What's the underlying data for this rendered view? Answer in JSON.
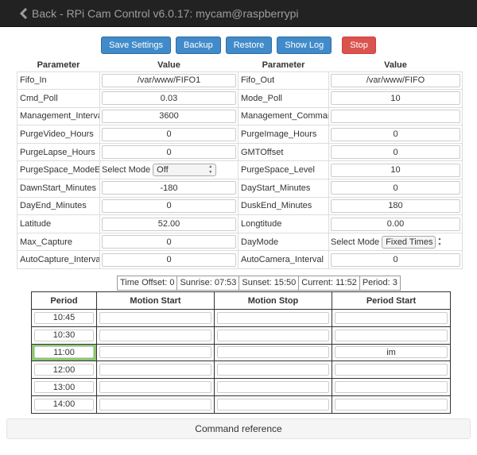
{
  "navbar": {
    "back_label": "Back - RPi Cam Control v6.0.17: mycam@raspberrypi"
  },
  "buttons": {
    "save_settings": "Save Settings",
    "backup": "Backup",
    "restore": "Restore",
    "show_log": "Show Log",
    "stop": "Stop"
  },
  "settings": {
    "headers": {
      "param_left": "Parameter",
      "value_left": "Value",
      "param_right": "Parameter",
      "value_right": "Value"
    },
    "rows": [
      {
        "left_label": "Fifo_In",
        "left_value": "/var/www/FIFO1",
        "right_label": "Fifo_Out",
        "right_value": "/var/www/FIFO"
      },
      {
        "left_label": "Cmd_Poll",
        "left_value": "0.03",
        "right_label": "Mode_Poll",
        "right_value": "10"
      },
      {
        "left_label": "Management_Interval",
        "left_value": "3600",
        "right_label": "Management_Command",
        "right_value": ""
      },
      {
        "left_label": "PurgeVideo_Hours",
        "left_value": "0",
        "right_label": "PurgeImage_Hours",
        "right_value": "0"
      },
      {
        "left_label": "PurgeLapse_Hours",
        "left_value": "0",
        "right_label": "GMTOffset",
        "right_value": "0"
      },
      {
        "left_label": "PurgeSpace_ModeEx",
        "left_select_prefix": "Select Mode",
        "left_select_value": "Off",
        "right_label": "PurgeSpace_Level",
        "right_value": "10"
      },
      {
        "left_label": "DawnStart_Minutes",
        "left_value": "-180",
        "right_label": "DayStart_Minutes",
        "right_value": "0"
      },
      {
        "left_label": "DayEnd_Minutes",
        "left_value": "0",
        "right_label": "DuskEnd_Minutes",
        "right_value": "180"
      },
      {
        "left_label": "Latitude",
        "left_value": "52.00",
        "right_label": "Longtitude",
        "right_value": "0.00"
      },
      {
        "left_label": "Max_Capture",
        "left_value": "0",
        "right_label": "DayMode",
        "right_select_prefix": "Select Mode",
        "right_select_value": "Fixed Times"
      },
      {
        "left_label": "AutoCapture_Interval",
        "left_value": "0",
        "right_label": "AutoCamera_Interval",
        "right_value": "0"
      }
    ]
  },
  "status": {
    "time_offset": "Time Offset: 0",
    "sunrise": "Sunrise: 07:53",
    "sunset": "Sunset: 15:50",
    "current": "Current: 11:52",
    "period": "Period: 3"
  },
  "schedule": {
    "headers": {
      "period": "Period",
      "motion_start": "Motion Start",
      "motion_stop": "Motion Stop",
      "period_start": "Period Start"
    },
    "highlight_color": "#8dc870",
    "rows": [
      {
        "period": "10:45",
        "motion_start": "",
        "motion_stop": "",
        "period_start": ""
      },
      {
        "period": "10:30",
        "motion_start": "",
        "motion_stop": "",
        "period_start": ""
      },
      {
        "period": "11:00",
        "motion_start": "",
        "motion_stop": "",
        "period_start": "im"
      },
      {
        "period": "12:00",
        "motion_start": "",
        "motion_stop": "",
        "period_start": ""
      },
      {
        "period": "13:00",
        "motion_start": "",
        "motion_stop": "",
        "period_start": ""
      },
      {
        "period": "14:00",
        "motion_start": "",
        "motion_stop": "",
        "period_start": ""
      }
    ]
  },
  "command_reference": "Command reference"
}
